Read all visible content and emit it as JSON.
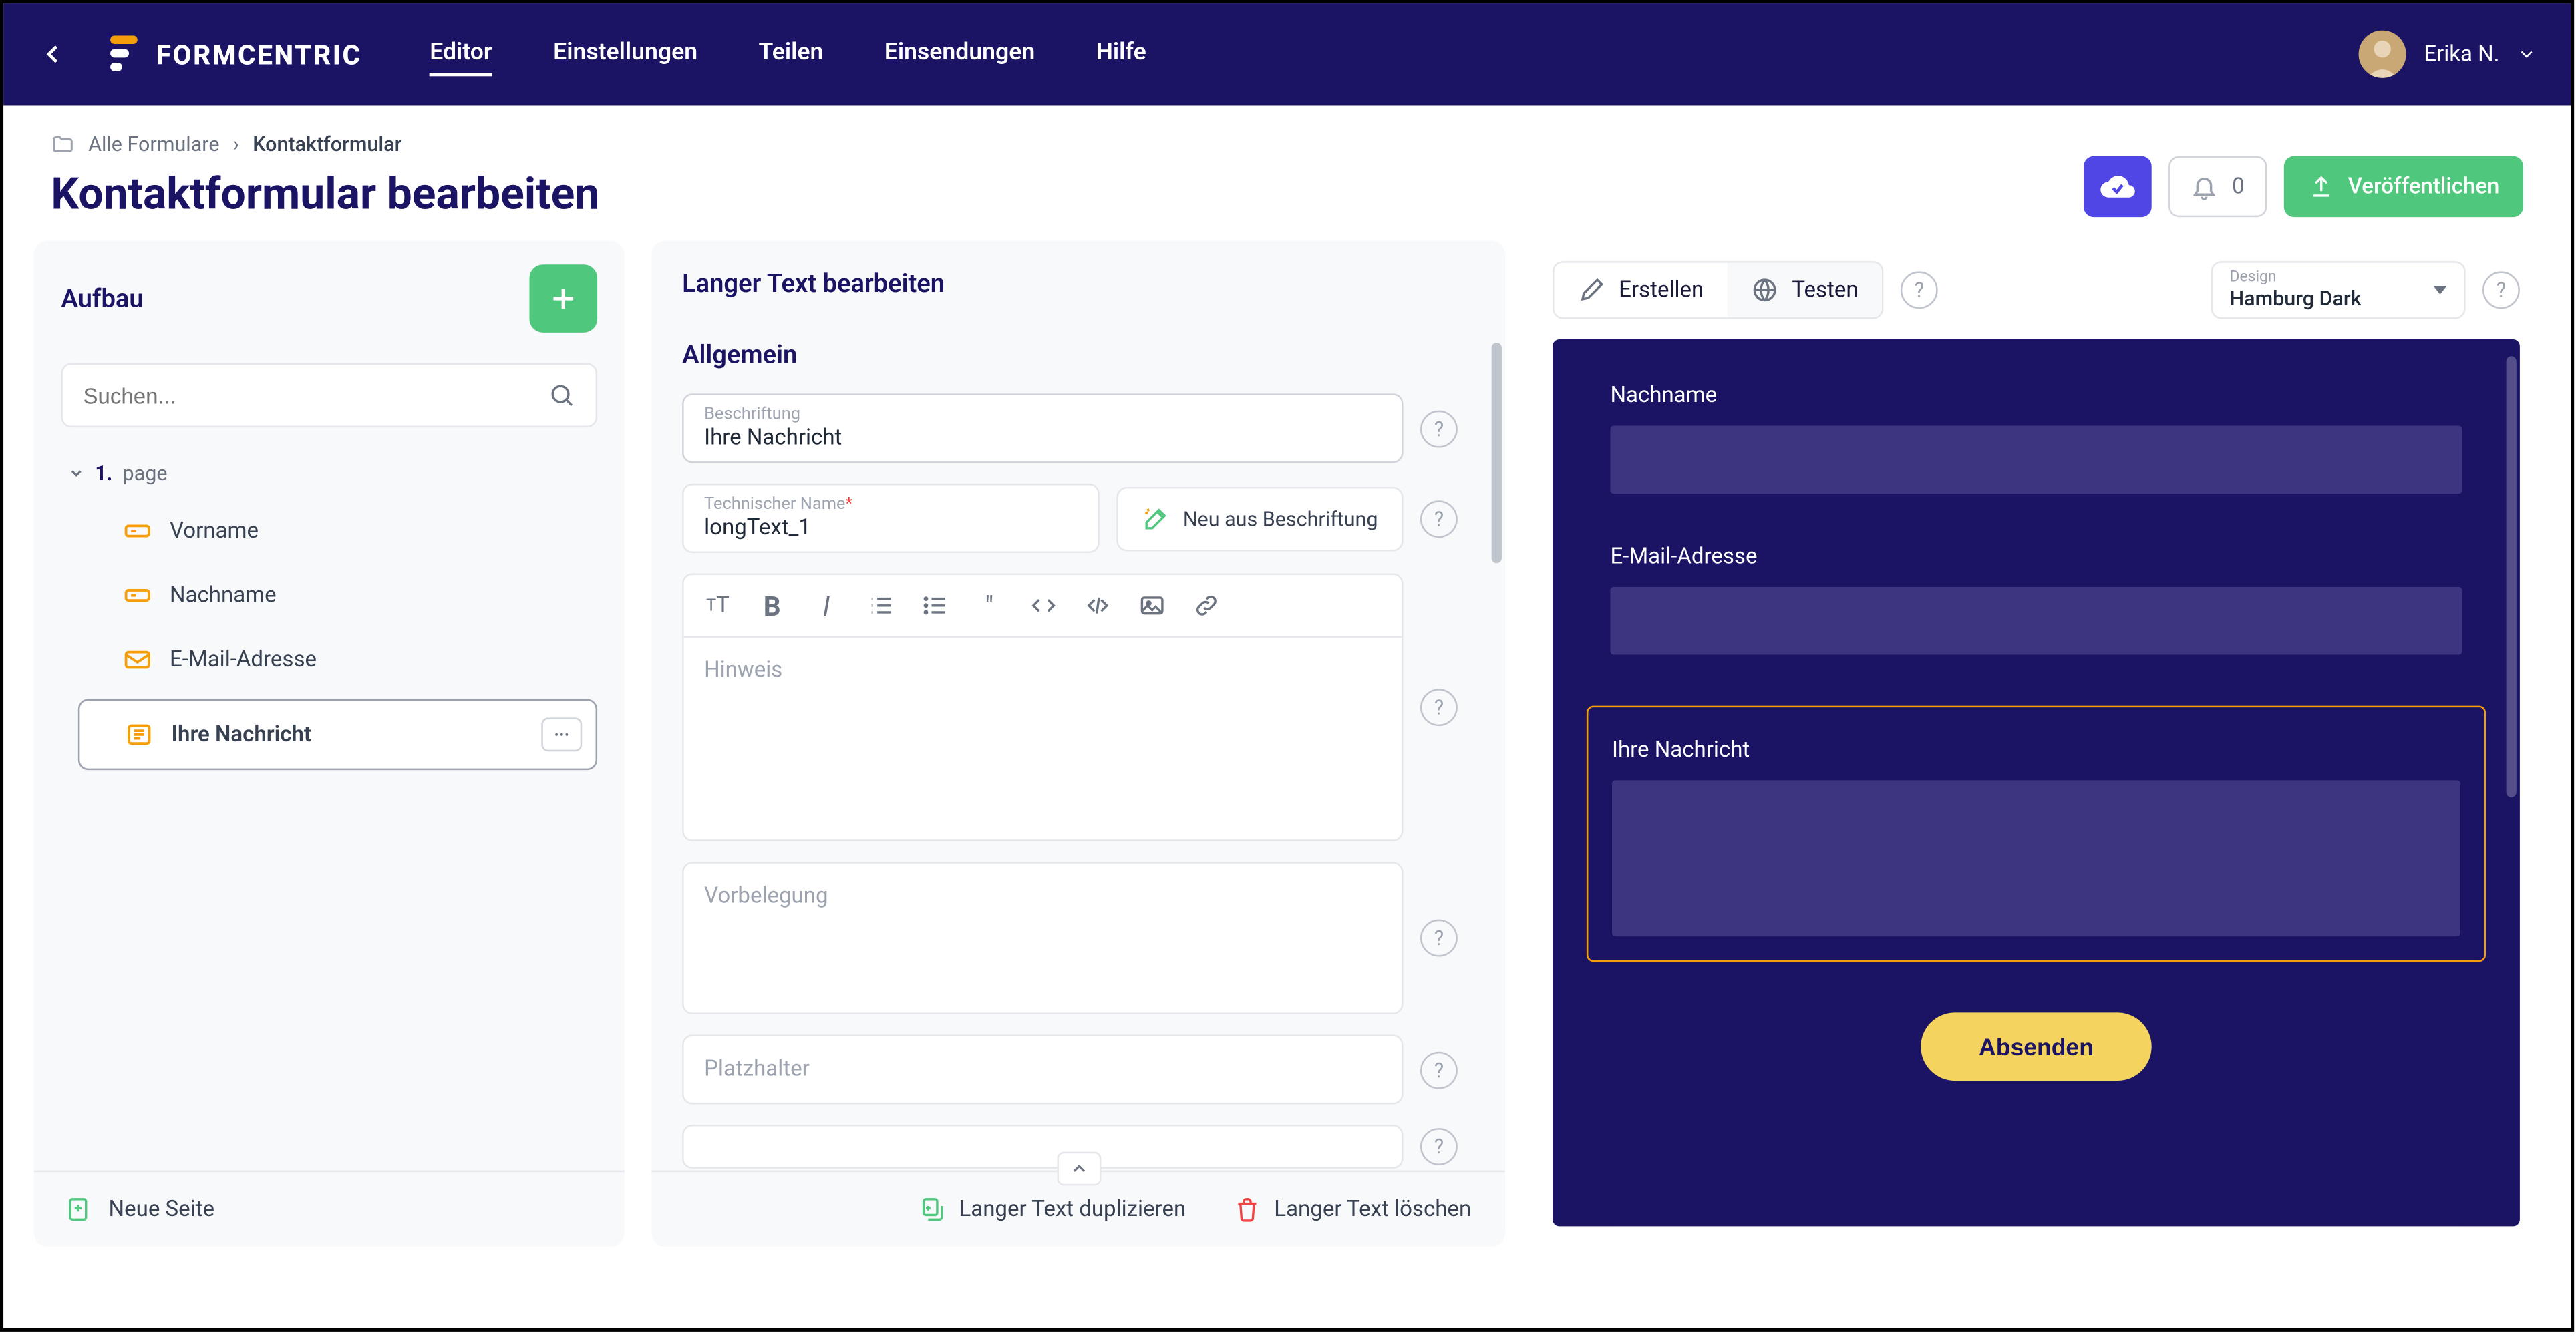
{
  "topbar": {
    "brand": "FORMCENTRIC",
    "tabs": [
      "Editor",
      "Einstellungen",
      "Teilen",
      "Einsendungen",
      "Hilfe"
    ],
    "user_name": "Erika N."
  },
  "header": {
    "breadcrumb_root": "Alle Formulare",
    "breadcrumb_current": "Kontaktformular",
    "title": "Kontaktformular bearbeiten",
    "notif_count": "0",
    "publish_label": "Veröffentlichen"
  },
  "structure": {
    "title": "Aufbau",
    "search_placeholder": "Suchen...",
    "page_prefix": "1.",
    "page_label": "page",
    "items": [
      {
        "label": "Vorname"
      },
      {
        "label": "Nachname"
      },
      {
        "label": "E-Mail-Adresse"
      },
      {
        "label": "Ihre Nachricht"
      }
    ],
    "new_page": "Neue Seite"
  },
  "props": {
    "title": "Langer Text bearbeiten",
    "section_general": "Allgemein",
    "label_field_label": "Beschriftung",
    "label_field_value": "Ihre Nachricht",
    "tech_name_label": "Technischer Name",
    "tech_name_value": "longText_1",
    "gen_from_label": "Neu aus Beschriftung",
    "hint_placeholder": "Hinweis",
    "default_placeholder": "Vorbelegung",
    "placeholder_placeholder": "Platzhalter",
    "footer_duplicate": "Langer Text duplizieren",
    "footer_delete": "Langer Text löschen"
  },
  "preview": {
    "mode_create": "Erstellen",
    "mode_test": "Testen",
    "design_label": "Design",
    "design_value": "Hamburg Dark",
    "fields": {
      "lastname": "Nachname",
      "email": "E-Mail-Adresse",
      "message": "Ihre Nachricht"
    },
    "submit": "Absenden"
  }
}
